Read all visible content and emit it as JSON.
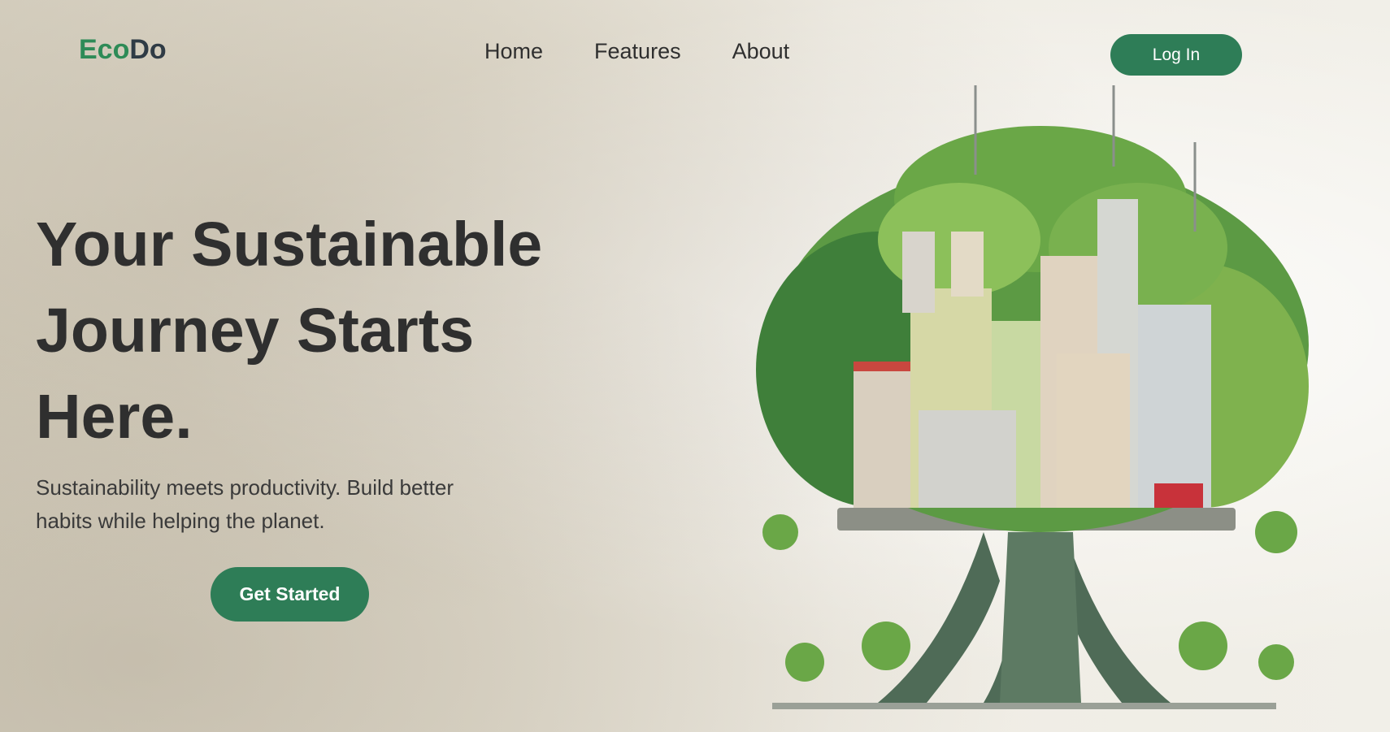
{
  "brand": {
    "part1": "Eco",
    "part2": "Do"
  },
  "nav": {
    "items": [
      "Home",
      "Features",
      "About"
    ]
  },
  "header": {
    "login_label": "Log In"
  },
  "hero": {
    "title_line1": "Your Sustainable",
    "title_line2": "Journey Starts",
    "title_line3": "Here.",
    "subtitle_line1": "Sustainability meets productivity. Build better",
    "subtitle_line2": "habits while helping the planet.",
    "cta_label": "Get Started"
  },
  "colors": {
    "accent": "#2e7d57",
    "brand_green": "#2e8b57",
    "brand_dark": "#2f3b45"
  }
}
